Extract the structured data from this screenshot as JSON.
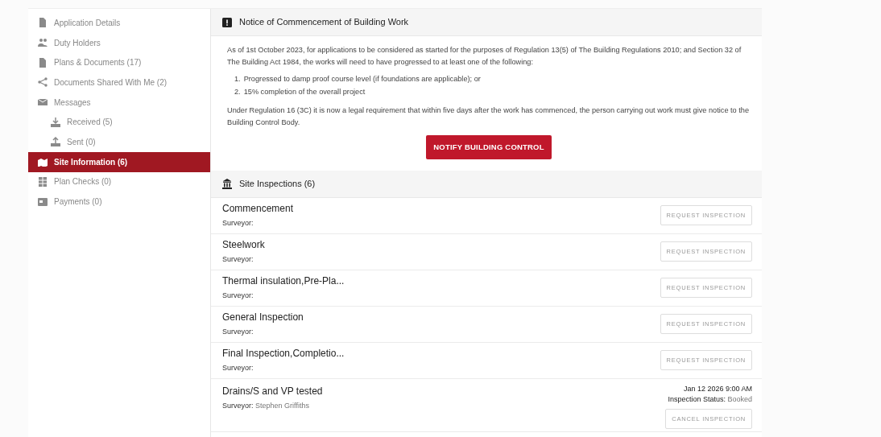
{
  "sidebar": {
    "items": [
      {
        "label": "Application Details",
        "kind": "file",
        "selected": false
      },
      {
        "label": "Duty Holders",
        "kind": "people",
        "selected": false
      },
      {
        "label": "Plans & Documents (17)",
        "kind": "file",
        "selected": false
      },
      {
        "label": "Documents Shared With Me (2)",
        "kind": "share",
        "selected": false
      },
      {
        "label": "Messages",
        "kind": "mail",
        "selected": false,
        "children": [
          {
            "label": "Received (5)",
            "kind": "download",
            "selected": false
          },
          {
            "label": "Sent (0)",
            "kind": "upload",
            "selected": false
          }
        ]
      },
      {
        "label": "Site Information (6)",
        "kind": "map",
        "selected": true
      },
      {
        "label": "Plan Checks (0)",
        "kind": "grid",
        "selected": false
      },
      {
        "label": "Payments (0)",
        "kind": "card",
        "selected": false
      }
    ]
  },
  "notice": {
    "title": "Notice of Commencement of Building Work",
    "intro": "As of 1st October 2023, for applications to be considered as started for the purposes of Regulation 13(5) of The Building Regulations 2010; and Section 32 of The Building Act 1984, the works will need to have progressed to at least one of the following:",
    "list": [
      {
        "number": "1.",
        "text": "Progressed to damp proof course level (if foundations are applicable); or"
      },
      {
        "number": "2.",
        "text": "15% completion of the overall project"
      }
    ],
    "outro": "Under Regulation 16 (3C) it is now a legal requirement that within five days after the work has commenced, the person carrying out work must give notice to the Building Control Body.",
    "button": "NOTIFY BUILDING CONTROL"
  },
  "inspections": {
    "title": "Site Inspections (6)",
    "rows": [
      {
        "title": "Commencement",
        "surveyor_label": "Surveyor:",
        "button": "REQUEST INSPECTION"
      },
      {
        "title": "Steelwork",
        "surveyor_label": "Surveyor:",
        "button": "REQUEST INSPECTION"
      },
      {
        "title": "Thermal insulation,Pre-Pla...",
        "surveyor_label": "Surveyor:",
        "button": "REQUEST INSPECTION"
      },
      {
        "title": "General Inspection",
        "surveyor_label": "Surveyor:",
        "button": "REQUEST INSPECTION"
      },
      {
        "title": "Final Inspection,Completio...",
        "surveyor_label": "Surveyor:",
        "button": "REQUEST INSPECTION"
      },
      {
        "title": "Drains/S and VP tested",
        "surveyor_label": "Surveyor:",
        "surveyor": "Stephen Griffiths",
        "date": "Jan 12 2026 9:00 AM",
        "status_label": "Inspection Status:",
        "status": "Booked",
        "button": "CANCEL INSPECTION"
      }
    ]
  }
}
